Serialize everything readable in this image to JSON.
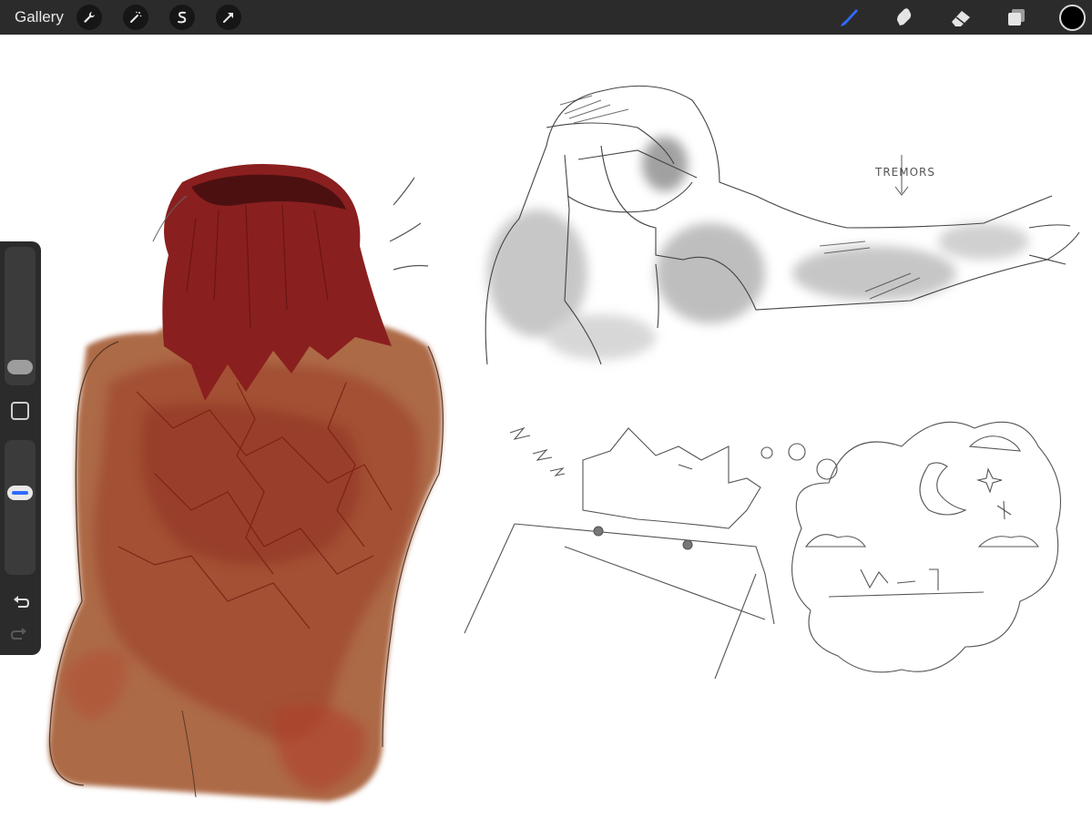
{
  "toolbar": {
    "gallery_label": "Gallery",
    "left_tools": [
      "wrench-icon",
      "magic-wand-icon",
      "selection-icon",
      "transform-arrow-icon"
    ],
    "right_tools": [
      "brush-icon",
      "smudge-icon",
      "eraser-icon",
      "layers-icon"
    ],
    "active_tool": "brush-icon",
    "accent_color": "#2f6bff",
    "current_color": "#000000"
  },
  "sidebar": {
    "brush_size": 0.06,
    "brush_opacity": 0.63
  },
  "canvas": {
    "annotation_text": "TREMORS"
  }
}
